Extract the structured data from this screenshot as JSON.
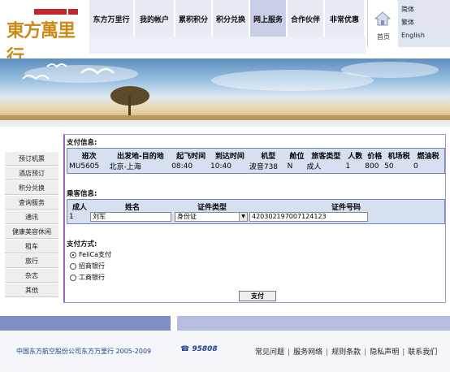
{
  "header": {
    "logo_text": "東方萬里行",
    "nav": [
      "东方万里行",
      "我的帐户",
      "累积积分",
      "积分兑换",
      "网上服务",
      "合作伙伴",
      "非常优惠"
    ],
    "home_label": "首页",
    "languages": [
      "简体",
      "繁体",
      "English"
    ]
  },
  "sidebar": {
    "items": [
      "预订机票",
      "酒店预订",
      "积分兑换",
      "查询服务",
      "通讯",
      "健康美容休闲",
      "租车",
      "旅行",
      "杂志",
      "其他"
    ]
  },
  "payment_info": {
    "title": "支付信息:",
    "headers": [
      "班次",
      "出发地-目的地",
      "起飞时间",
      "到达时间",
      "机型",
      "舱位",
      "旅客类型",
      "人数",
      "价格",
      "机场税",
      "燃油税"
    ],
    "rows": [
      [
        "MU5605",
        "北京-上海",
        "08:40",
        "10:40",
        "波音738",
        "N",
        "成人",
        "1",
        "800",
        "50",
        "0"
      ]
    ]
  },
  "passenger_info": {
    "title": "乘客信息:",
    "headers": [
      "成人",
      "姓名",
      "证件类型",
      "证件号码"
    ],
    "rows": [
      {
        "index": "1",
        "name": "刘军",
        "id_type": "身份证",
        "id_number": "420302197007124123"
      }
    ]
  },
  "payment_method": {
    "title": "支付方式:",
    "options": [
      {
        "label": "FeliCa支付",
        "checked": true
      },
      {
        "label": "招商银行",
        "checked": false
      },
      {
        "label": "工商银行",
        "checked": false
      }
    ],
    "submit_label": "支付"
  },
  "footer": {
    "copyright": "中国东方航空股份公司东方万里行 2005-2009",
    "hotline": "95808",
    "links": [
      "常见问题",
      "服务网络",
      "规则条款",
      "隐私声明",
      "联系我们"
    ]
  },
  "colors": {
    "frame_border": "#9d62c6",
    "table_border": "#6e86b8",
    "footer_bar": "#7d8fc4",
    "logo": "#cc8a16"
  }
}
